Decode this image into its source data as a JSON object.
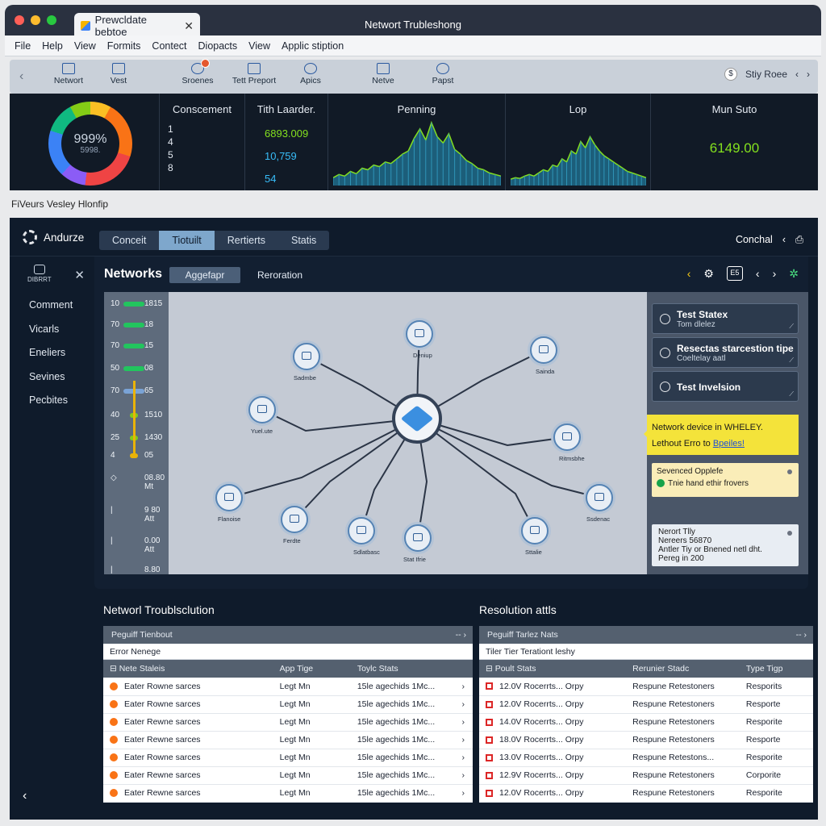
{
  "window": {
    "title": "Networt Trubleshong",
    "tab_title": "Prewcldate bebtoe"
  },
  "menu": [
    "File",
    "Help",
    "View",
    "Formits",
    "Contect",
    "Diopacts",
    "View",
    "Applic stiption"
  ],
  "toolbar": {
    "items": [
      {
        "label": "Networt",
        "icon": "network-icon"
      },
      {
        "label": "Vest",
        "icon": "chart-icon"
      },
      {
        "label": "Sroenes",
        "icon": "globe-icon"
      },
      {
        "label": "Tett Preport",
        "icon": "report-icon"
      },
      {
        "label": "Apics",
        "icon": "globe-icon"
      },
      {
        "label": "Netve",
        "icon": "grid-icon"
      },
      {
        "label": "Papst",
        "icon": "pie-icon"
      }
    ],
    "user": "Stiy Roee",
    "user_glyph": "$"
  },
  "stats": {
    "donut_value": "999%",
    "donut_sub": "5998.",
    "conscement": {
      "title": "Conscement",
      "items": [
        "1",
        "4",
        "5",
        "8"
      ]
    },
    "leader": {
      "title": "Tith Laarder.",
      "values": [
        "6893.009",
        "10,759",
        "54"
      ]
    },
    "penning": {
      "title": "Penning"
    },
    "lop": {
      "title": "Lop"
    },
    "munsuto": {
      "title": "Mun Suto",
      "value": "6149.00"
    }
  },
  "chart_data": [
    {
      "type": "area",
      "title": "Penning",
      "values": [
        10,
        14,
        12,
        18,
        15,
        22,
        20,
        26,
        24,
        30,
        28,
        34,
        40,
        44,
        60,
        72,
        58,
        80,
        62,
        54,
        66,
        46,
        40,
        32,
        28,
        22,
        20,
        16,
        14,
        12
      ]
    },
    {
      "type": "area",
      "title": "Lop",
      "values": [
        8,
        10,
        9,
        12,
        14,
        12,
        16,
        20,
        18,
        26,
        24,
        34,
        30,
        44,
        40,
        56,
        48,
        62,
        52,
        44,
        38,
        34,
        30,
        26,
        22,
        18,
        16,
        14,
        12,
        10
      ]
    }
  ],
  "section_label": "FiVeurs Vesley Hlonfip",
  "app": {
    "logo": "Andurze",
    "segments": [
      "Conceit",
      "Tiotuilt",
      "Rertierts",
      "Statis"
    ],
    "active_segment": 1,
    "header_right": "Conchal"
  },
  "sidebar": {
    "device_label": "DIBRRT",
    "items": [
      "Comment",
      "Vicarls",
      "Eneliers",
      "Sevines",
      "Pecbites"
    ]
  },
  "network": {
    "title": "Networks",
    "tab_active": "Aggefapr",
    "tab_other": "Reroration",
    "box_label": "E5",
    "levels": [
      {
        "a": "10",
        "b": "1815"
      },
      {
        "a": "70",
        "b": "18"
      },
      {
        "a": "70",
        "b": "15"
      },
      {
        "a": "50",
        "b": "08"
      },
      {
        "a": "70",
        "b": "65"
      },
      {
        "a": "40",
        "b": "1510"
      },
      {
        "a": "25",
        "b": "1430"
      },
      {
        "a": "4",
        "b": "05"
      },
      {
        "a": "◇",
        "b": "08.80 Mt"
      },
      {
        "a": "|",
        "b": "9 80 Att"
      },
      {
        "a": "|",
        "b": "0.00 Att"
      },
      {
        "a": "|",
        "b": "8.80"
      }
    ],
    "nodes": [
      "Deniup",
      "Sadmbe",
      "Sainda",
      "Yuel.ute",
      "Ritmsbhe",
      "Flanoise",
      "Ferdte",
      "Sdlatbasc",
      "Stat Ifrie",
      "Sttalie",
      "Ssdenac"
    ],
    "cards": [
      {
        "title": "Test Statex",
        "sub": "Tom dlelez"
      },
      {
        "title": "Resectas starcestion tipe",
        "sub": "Coeltelay aatl"
      },
      {
        "title": "Test Invelsion",
        "sub": ""
      }
    ],
    "alert": {
      "line1": "Network device in WHELEY.",
      "line2_prefix": "Lethout Erro to ",
      "line2_link": "Bpeiles!"
    },
    "notif1": {
      "title": "Sevenced Opplefe",
      "body": "Tnie hand ethir frovers"
    },
    "notif2": {
      "l1": "Nerort Tlly",
      "l2": "Nereers 56870",
      "l3": "Antler Tiy or Bnened netl dht.",
      "l4": "Pereg in 200"
    }
  },
  "troubleshoot": {
    "title": "Networl Troublsclution",
    "bar": "Peguiff Tienbout",
    "sub": "Error Nenege",
    "columns": [
      "Nete Staleis",
      "App Tige",
      "Toylc Stats"
    ],
    "rows": [
      [
        "Eater Rowne sarces",
        "Legt Mn",
        "15le agechids 1Mc..."
      ],
      [
        "Eater Rowne sarces",
        "Legt Mn",
        "15le agechids 1Mc..."
      ],
      [
        "Eater Rewne sarces",
        "Legt Mn",
        "15le agechids 1Mc..."
      ],
      [
        "Eater Rewne sarces",
        "Legt Mn",
        "15le agechids 1Mc..."
      ],
      [
        "Eater Rowne sarces",
        "Legt Mn",
        "15le agechids 1Mc..."
      ],
      [
        "Eater Rewne sarces",
        "Legt Mn",
        "15le agechids 1Mc..."
      ],
      [
        "Eater Rewne sarces",
        "Legt Mn",
        "15le agechids 1Mc..."
      ]
    ]
  },
  "resolution": {
    "title": "Resolution attls",
    "bar": "Peguiff Tarlez Nats",
    "sub": "Tiler Tier Terationt leshy",
    "columns": [
      "Poult Stats",
      "Rerunier Stadc",
      "Type Tigp"
    ],
    "rows": [
      [
        "12.0V Rocerrts... Orpy",
        "Respune Retestoners",
        "Resporits"
      ],
      [
        "12.0V Rocerrts... Orpy",
        "Respune Retestoners",
        "Resporte"
      ],
      [
        "14.0V Rocerrts... Orpy",
        "Respune Retestoners",
        "Resporite"
      ],
      [
        "18.0V Rocerrts... Orpy",
        "Respune Retestoners",
        "Resporte"
      ],
      [
        "13.0V Rocerrts... Orpy",
        "Respune Retestons...",
        "Resporite"
      ],
      [
        "12.9V Rocerrts... Orpy",
        "Respune Retestoners",
        "Corporite"
      ],
      [
        "12.0V Rocerrts... Orpy",
        "Respune Retestoners",
        "Resporite"
      ]
    ]
  }
}
